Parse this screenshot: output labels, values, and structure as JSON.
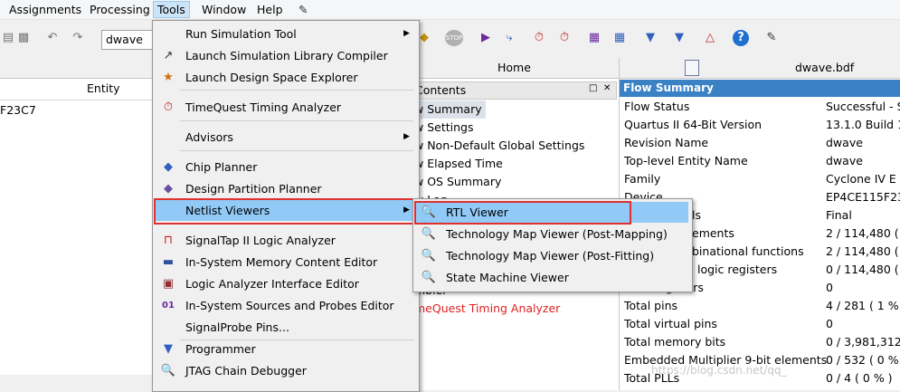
{
  "menubar": {
    "items": [
      "Assignments",
      "Processing",
      "Tools",
      "Window",
      "Help"
    ]
  },
  "toolbar": {
    "entity_value": "dwave"
  },
  "left_panel": {
    "header": "Entity",
    "row": "F23C7"
  },
  "center_panel": {
    "tab": "Home",
    "toc_title": "Contents",
    "items": [
      "w Summary",
      "w Settings",
      "w Non-Default Global Settings",
      "w Elapsed Time",
      "w OS Summary",
      "w Log",
      "mbler",
      "meQuest Timing Analyzer"
    ]
  },
  "right_panel": {
    "tab": "dwave.bdf",
    "title": "Flow Summary",
    "rows": [
      {
        "k": "Flow Status",
        "v": "Successful - S"
      },
      {
        "k": "Quartus II 64-Bit Version",
        "v": "13.1.0 Build 16"
      },
      {
        "k": "Revision Name",
        "v": "dwave"
      },
      {
        "k": "Top-level Entity Name",
        "v": "dwave"
      },
      {
        "k": "Family",
        "v": "Cyclone IV E"
      },
      {
        "k": "Device",
        "v": "EP4CE115F23C"
      },
      {
        "k": "ls",
        "v": "Final"
      },
      {
        "k": "ements",
        "v": "2 / 114,480 ( <"
      },
      {
        "k": "binational functions",
        "v": "2 / 114,480 ( <"
      },
      {
        "k": "logic registers",
        "v": "0 / 114,480 ( 0"
      },
      {
        "k": "Total registers",
        "v": "0"
      },
      {
        "k": "Total pins",
        "v": "4 / 281 ( 1 % )"
      },
      {
        "k": "Total virtual pins",
        "v": "0"
      },
      {
        "k": "Total memory bits",
        "v": "0 / 3,981,312 ("
      },
      {
        "k": "Embedded Multiplier 9-bit elements",
        "v": "0 / 532 ( 0 % )"
      },
      {
        "k": "Total PLLs",
        "v": "0 / 4 ( 0 % )"
      }
    ]
  },
  "tools_menu": {
    "items": [
      {
        "label": "Run Simulation Tool",
        "icon": "none",
        "submenu": true
      },
      {
        "label": "Launch Simulation Library Compiler",
        "icon": "library-compiler-icon"
      },
      {
        "label": "Launch Design Space Explorer",
        "icon": "dse-icon"
      },
      {
        "label": "TimeQuest Timing Analyzer",
        "icon": "stopwatch-icon"
      },
      {
        "label": "Advisors",
        "icon": "none",
        "submenu": true
      },
      {
        "label": "Chip Planner",
        "icon": "chip-planner-icon"
      },
      {
        "label": "Design Partition Planner",
        "icon": "partition-planner-icon"
      },
      {
        "label": "Netlist Viewers",
        "icon": "none",
        "submenu": true
      },
      {
        "label": "SignalTap II Logic Analyzer",
        "icon": "signaltap-icon"
      },
      {
        "label": "In-System Memory Content Editor",
        "icon": "memory-editor-icon"
      },
      {
        "label": "Logic Analyzer Interface Editor",
        "icon": "lai-editor-icon"
      },
      {
        "label": "In-System Sources and Probes Editor",
        "icon": "sources-probes-icon"
      },
      {
        "label": "SignalProbe Pins...",
        "icon": "none"
      },
      {
        "label": "Programmer",
        "icon": "programmer-icon"
      },
      {
        "label": "JTAG Chain Debugger",
        "icon": "jtag-debugger-icon"
      }
    ]
  },
  "netlist_submenu": {
    "items": [
      {
        "label": "RTL Viewer",
        "icon": "rtl-viewer-icon"
      },
      {
        "label": "Technology Map Viewer (Post-Mapping)",
        "icon": "techmap-mapping-icon"
      },
      {
        "label": "Technology Map Viewer (Post-Fitting)",
        "icon": "techmap-fitting-icon"
      },
      {
        "label": "State Machine Viewer",
        "icon": "state-machine-icon"
      }
    ]
  },
  "watermark": "https://blog.csdn.net/qq_"
}
